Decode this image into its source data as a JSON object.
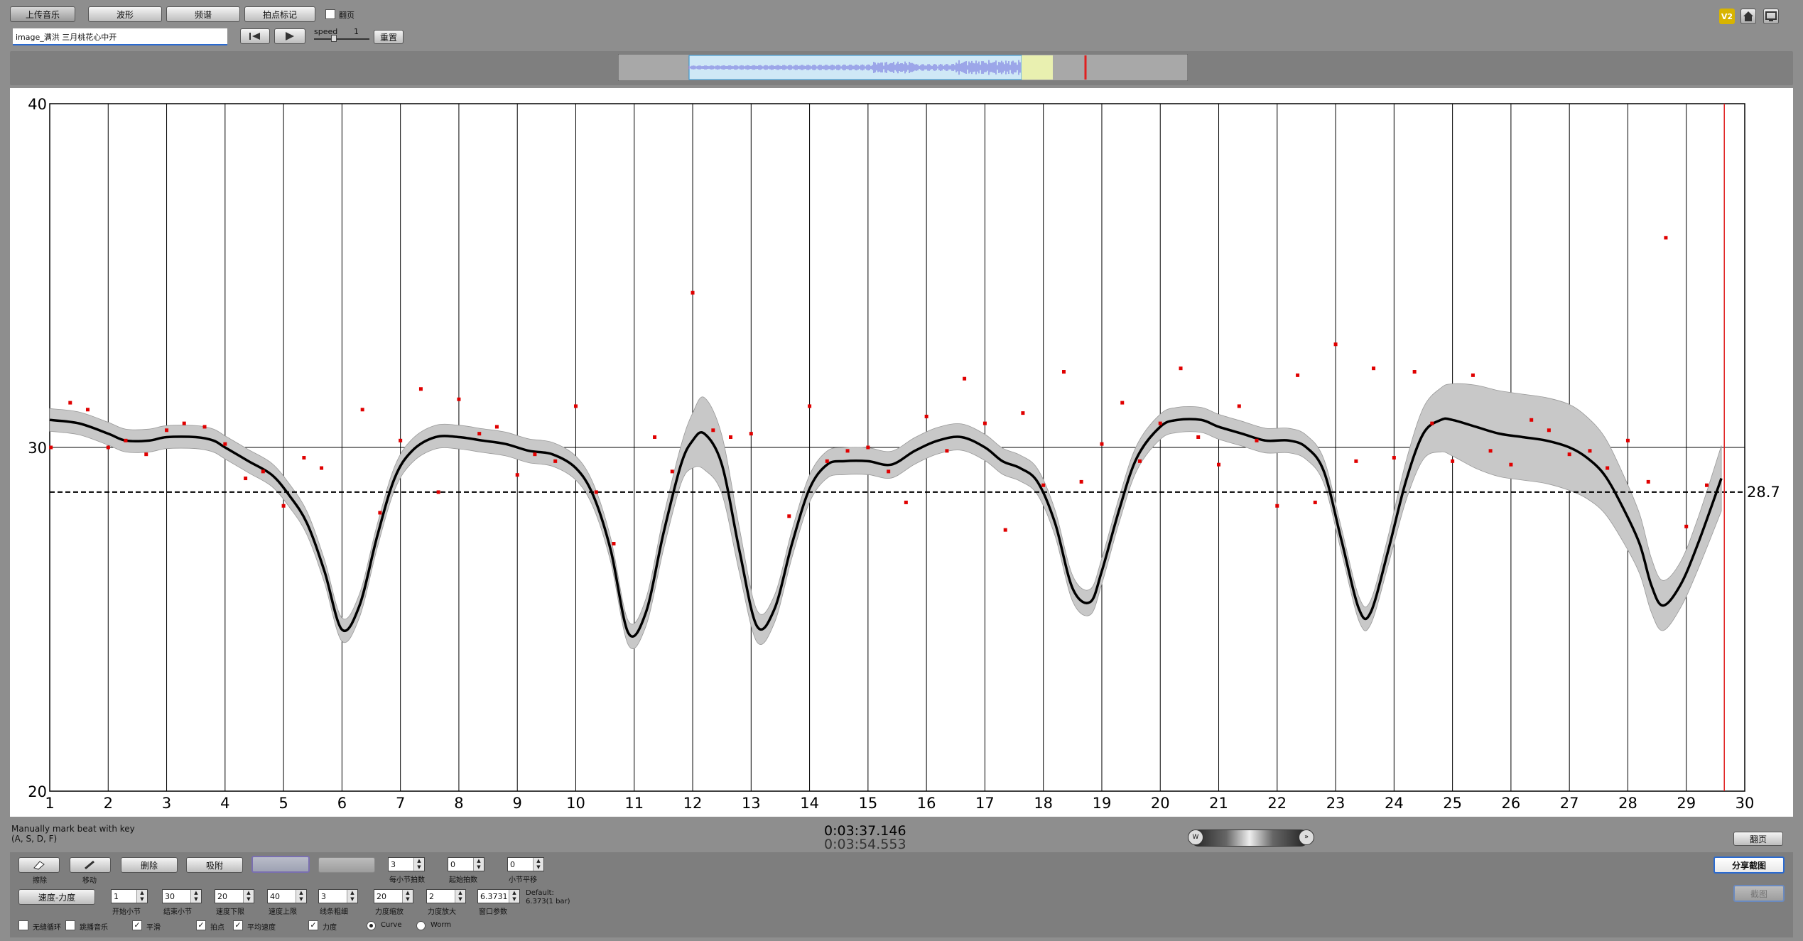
{
  "toolbar": {
    "upload_label": "上传音乐",
    "waveform_label": "波形",
    "spectrum_label": "频谱",
    "beat_mark_label": "拍点标记",
    "flip_label": "翻页",
    "speed_label": "speed",
    "speed_value": "1",
    "reset_label": "重置",
    "filename": "image_满洪 三月桃花心中开"
  },
  "colors": {
    "accent": "#2a6ad0",
    "points": "#e00000",
    "curve": "#000000",
    "band": "#c8c8c8",
    "playhead": "#e02020",
    "badge": "#d8b400"
  },
  "header_icons": [
    "v2-badge-icon",
    "home-icon",
    "screen-icon"
  ],
  "status": {
    "hint_line1": "Manually mark beat with key",
    "hint_line2": "(A, S, D, F)",
    "time_current": "0:03:37.146",
    "time_total": "0:03:54.553",
    "scroll_label": "翻页"
  },
  "chart_data": {
    "type": "line",
    "title": "",
    "xlabel": "",
    "ylabel": "",
    "xlim": [
      1,
      30
    ],
    "ylim": [
      20,
      40
    ],
    "x_ticks": [
      1,
      2,
      3,
      4,
      5,
      6,
      7,
      8,
      9,
      10,
      11,
      12,
      13,
      14,
      15,
      16,
      17,
      18,
      19,
      20,
      21,
      22,
      23,
      24,
      25,
      26,
      27,
      28,
      29,
      30
    ],
    "y_ticks": [
      20,
      30,
      40
    ],
    "grid": "vertical lines at each bar, horizontal line at 30",
    "reference_line": {
      "value": 28.7,
      "label": "28.7",
      "style": "dashed"
    },
    "playhead_x": 29.65,
    "smoothed_curve": {
      "x": [
        1,
        1.5,
        2,
        2.3,
        2.7,
        3,
        3.5,
        3.8,
        4,
        4.4,
        4.8,
        5.1,
        5.4,
        5.7,
        6,
        6.3,
        6.6,
        6.9,
        7.2,
        7.6,
        8,
        8.4,
        8.8,
        9.2,
        9.6,
        10,
        10.3,
        10.6,
        10.9,
        11.2,
        11.5,
        11.8,
        12,
        12.2,
        12.5,
        12.8,
        13.1,
        13.4,
        13.7,
        14,
        14.3,
        14.6,
        15,
        15.4,
        15.8,
        16.2,
        16.6,
        17,
        17.3,
        17.6,
        17.9,
        18.2,
        18.5,
        18.8,
        19,
        19.3,
        19.6,
        20,
        20.3,
        20.7,
        21,
        21.4,
        21.8,
        22.2,
        22.5,
        22.8,
        23.1,
        23.4,
        23.6,
        23.9,
        24.2,
        24.5,
        24.8,
        25,
        25.4,
        25.8,
        26.2,
        26.6,
        27,
        27.3,
        27.6,
        27.9,
        28.2,
        28.4,
        28.6,
        28.9,
        29.2,
        29.6
      ],
      "y": [
        30.8,
        30.7,
        30.4,
        30.2,
        30.2,
        30.3,
        30.3,
        30.2,
        30.0,
        29.6,
        29.2,
        28.6,
        27.8,
        26.4,
        24.7,
        25.4,
        27.4,
        29.1,
        29.9,
        30.3,
        30.3,
        30.2,
        30.1,
        29.9,
        29.8,
        29.4,
        28.6,
        27.0,
        24.6,
        25.2,
        27.5,
        29.5,
        30.2,
        30.4,
        29.5,
        27.0,
        24.8,
        25.3,
        27.2,
        28.8,
        29.5,
        29.6,
        29.6,
        29.5,
        29.9,
        30.2,
        30.3,
        30.0,
        29.6,
        29.4,
        29.0,
        27.8,
        25.9,
        25.5,
        26.4,
        28.2,
        29.7,
        30.6,
        30.8,
        30.8,
        30.6,
        30.4,
        30.2,
        30.2,
        30.0,
        29.3,
        27.3,
        25.3,
        25.2,
        27.0,
        29.0,
        30.4,
        30.8,
        30.8,
        30.6,
        30.4,
        30.3,
        30.2,
        30.0,
        29.7,
        29.2,
        28.3,
        27.2,
        26.0,
        25.4,
        26.0,
        27.2,
        29.1
      ]
    },
    "band_halfwidth": {
      "x": [
        1,
        11,
        11.8,
        12.2,
        12.8,
        13.2,
        23.6,
        24,
        24.5,
        25,
        25.5,
        26,
        26.5,
        27,
        27.5,
        28,
        28.5,
        29,
        29.6
      ],
      "y": [
        0.18,
        0.2,
        0.4,
        0.9,
        0.5,
        0.25,
        0.2,
        0.3,
        0.6,
        0.9,
        1.1,
        1.1,
        1.1,
        1.1,
        1.0,
        0.8,
        0.6,
        0.5,
        0.8
      ]
    },
    "beat_points": {
      "x": [
        1.02,
        1.35,
        1.65,
        2.0,
        2.3,
        2.65,
        3.0,
        3.3,
        3.65,
        4.0,
        4.35,
        4.65,
        5.0,
        5.35,
        5.65,
        6.35,
        6.65,
        7.0,
        7.35,
        7.65,
        8.0,
        8.35,
        8.65,
        9.0,
        9.3,
        9.65,
        10.0,
        10.35,
        10.65,
        11.35,
        11.65,
        12.0,
        12.35,
        12.65,
        13.0,
        13.65,
        14.0,
        14.3,
        14.65,
        15.0,
        15.35,
        15.65,
        16.0,
        16.35,
        16.65,
        17.0,
        17.35,
        17.65,
        18.0,
        18.35,
        18.65,
        19.0,
        19.35,
        19.65,
        20.0,
        20.35,
        20.65,
        21.0,
        21.35,
        21.65,
        22.0,
        22.35,
        22.65,
        23.0,
        23.35,
        23.65,
        24.0,
        24.35,
        24.65,
        25.0,
        25.35,
        25.65,
        26.0,
        26.35,
        26.65,
        27.0,
        27.35,
        27.65,
        28.0,
        28.35,
        28.65,
        29.0,
        29.35
      ],
      "y": [
        30.0,
        31.3,
        31.1,
        30.0,
        30.2,
        29.8,
        30.5,
        30.7,
        30.6,
        30.1,
        29.1,
        29.3,
        28.3,
        29.7,
        29.4,
        31.1,
        28.1,
        30.2,
        31.7,
        28.7,
        31.4,
        30.4,
        30.6,
        29.2,
        29.8,
        29.6,
        31.2,
        28.7,
        27.2,
        30.3,
        29.3,
        34.5,
        30.5,
        30.3,
        30.4,
        28.0,
        31.2,
        29.6,
        29.9,
        30.0,
        29.3,
        28.4,
        30.9,
        29.9,
        32.0,
        30.7,
        27.6,
        31.0,
        28.9,
        32.2,
        29.0,
        30.1,
        31.3,
        29.6,
        30.7,
        32.3,
        30.3,
        29.5,
        31.2,
        30.2,
        28.3,
        32.1,
        28.4,
        33.0,
        29.6,
        32.3,
        29.7,
        32.2,
        30.7,
        29.6,
        32.1,
        29.9,
        29.5,
        30.8,
        30.5,
        29.8,
        29.9,
        29.4,
        30.2,
        29.0,
        36.1,
        27.7,
        28.9
      ]
    }
  },
  "controls": {
    "erase_label": "擦除",
    "move_label": "移动",
    "delete_label": "删除",
    "snap_label": "吸附",
    "btn5_label": "",
    "btn6_label": "",
    "tempo_dynamics_label": "速度-力度",
    "per_bar_beats_label": "每小节拍数",
    "per_bar_beats_value": "3",
    "start_beat_label": "起始拍数",
    "start_beat_value": "0",
    "bar_offset_label": "小节平移",
    "bar_offset_value": "0",
    "start_bar_label": "开始小节",
    "start_bar_value": "1",
    "end_bar_label": "结束小节",
    "end_bar_value": "30",
    "tempo_min_label": "速度下限",
    "tempo_min_value": "20",
    "tempo_max_label": "速度上限",
    "tempo_max_value": "40",
    "line_width_label": "线条粗细",
    "line_width_value": "3",
    "dyn_shrink_label": "力度缩放",
    "dyn_shrink_value": "20",
    "dyn_zoom_label": "力度放大",
    "dyn_zoom_value": "2",
    "window_param_label": "窗口参数",
    "window_param_value": "6.3731",
    "default_line1": "Default:",
    "default_line2": "6.373(1 bar)",
    "cb_infinite_loop": "无缝循环",
    "cb_skip_music": "跳播音乐",
    "cb_smooth": "平滑",
    "cb_beat_points": "拍点",
    "cb_avg_tempo": "平均速度",
    "cb_dynamics": "力度",
    "radio_curve": "Curve",
    "radio_worm": "Worm",
    "share_label": "分享截图",
    "disabled_right_label": "",
    "stop_label": "截图"
  }
}
